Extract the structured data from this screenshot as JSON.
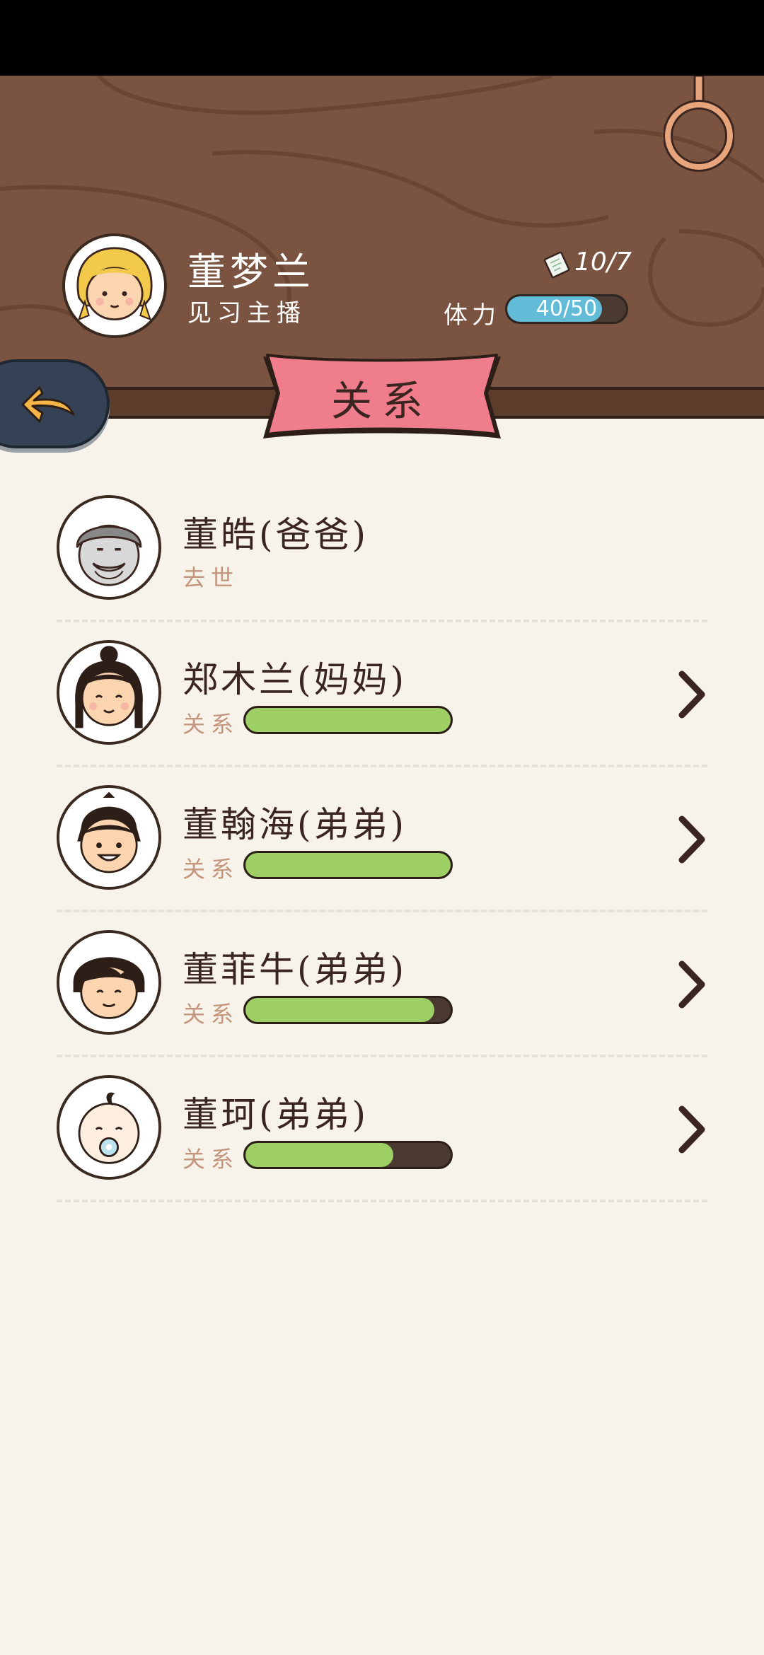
{
  "header": {
    "player_name": "董梦兰",
    "player_title": "见习主播",
    "ticket_count": "10/7",
    "stamina_label": "体力",
    "stamina_text": "40/50",
    "stamina_fraction": 0.8
  },
  "banner": {
    "title": "关系"
  },
  "relations": [
    {
      "name": "董皓(爸爸)",
      "status": "去世",
      "bar_label": "",
      "level": null,
      "has_chevron": false,
      "avatar": "grandpa-avatar-icon"
    },
    {
      "name": "郑木兰(妈妈)",
      "status": "",
      "bar_label": "关系",
      "level": 1.0,
      "has_chevron": true,
      "avatar": "mother-avatar-icon"
    },
    {
      "name": "董翰海(弟弟)",
      "status": "",
      "bar_label": "关系",
      "level": 1.0,
      "has_chevron": true,
      "avatar": "boy-avatar-icon"
    },
    {
      "name": "董菲牛(弟弟)",
      "status": "",
      "bar_label": "关系",
      "level": 0.92,
      "has_chevron": true,
      "avatar": "boy2-avatar-icon"
    },
    {
      "name": "董珂(弟弟)",
      "status": "",
      "bar_label": "关系",
      "level": 0.72,
      "has_chevron": true,
      "avatar": "baby-avatar-icon"
    }
  ],
  "colors": {
    "wood": "#7a5440",
    "stamina": "#63bcd7",
    "relation_bar": "#9ed065",
    "banner": "#f07d8c"
  }
}
